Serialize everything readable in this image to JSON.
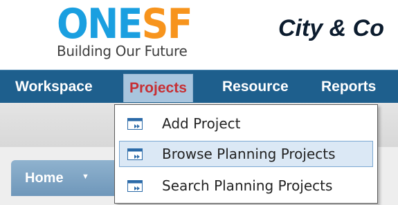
{
  "header": {
    "logo_one": "ONE",
    "logo_sf": "SF",
    "tagline": "Building Our Future",
    "title": "City & Co"
  },
  "nav": {
    "items": [
      {
        "label": "Workspace"
      },
      {
        "label": "Projects"
      },
      {
        "label": "Resource"
      },
      {
        "label": "Reports"
      }
    ],
    "active": "Projects"
  },
  "home_tab": {
    "label": "Home",
    "caret": "▼"
  },
  "projects_menu": {
    "items": [
      {
        "label": "Add Project",
        "icon": "project-icon"
      },
      {
        "label": "Browse Planning Projects",
        "icon": "project-icon"
      },
      {
        "label": "Search Planning Projects",
        "icon": "project-icon"
      }
    ],
    "highlighted": "Browse Planning Projects"
  },
  "colors": {
    "nav_bg": "#1e5f8d",
    "nav_active_text": "#c72f34",
    "logo_blue": "#1a9fe0",
    "logo_orange": "#f7941d"
  }
}
